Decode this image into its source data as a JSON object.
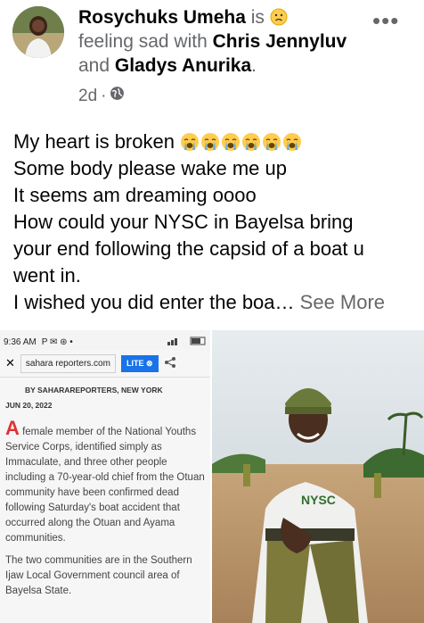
{
  "post": {
    "author": "Rosychuks Umeha",
    "is_text": "is",
    "feeling_text": "feeling sad with",
    "tagged_1": "Chris Jennyluv",
    "and_text": "and",
    "tagged_2": "Gladys Anurika",
    "period": ".",
    "time": "2d",
    "dot": "·",
    "more_label": "•••",
    "lines": [
      "My heart is broken",
      "Some body please wake me up",
      "It seems am dreaming oooo",
      "How could your NYSC in Bayelsa bring",
      "your end following the capsid of a boat u",
      "went in.",
      "I wished you did enter the boa…"
    ],
    "see_more": "See More"
  },
  "screenshot": {
    "status_time": "9:36 AM",
    "status_icons": "P ✉ ⊛ •",
    "close": "✕",
    "url": "sahara reporters.com",
    "lite": "LITE ⊗",
    "byline": "BY SAHARAREPORTERS, NEW YORK",
    "date": "JUN 20, 2022",
    "dropcap": "A",
    "para1": "female member of the National Youths Service Corps, identified simply as Immaculate, and three other people including a 70-year-old chief from the Otuan community have been confirmed dead following Saturday's boat accident that occurred along the Otuan and Ayama communities.",
    "para2": "The two communities are in the Southern Ijaw Local Government council area of Bayelsa State."
  },
  "colors": {
    "text": "#050505",
    "secondary": "#65676b",
    "link": "#1a73e8",
    "dropcap": "#dd3333"
  }
}
